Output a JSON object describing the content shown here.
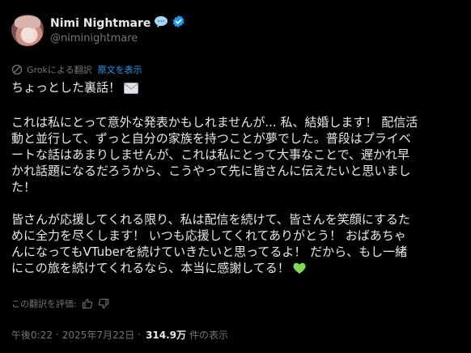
{
  "author": {
    "display_name": "Nimi Nightmare",
    "handle": "@niminightmare"
  },
  "translation": {
    "label": "Grokによる翻訳",
    "show_original": "原文を表示"
  },
  "post": {
    "line1": "ちょっとした裏話！",
    "para1_line1": "これは私にとって意外な発表かもしれませんが... 私、結婚します！ 配信活",
    "para1_line2": "動と並行して、ずっと自分の家族を持つことが夢でした。普段はプライベ",
    "para1_line3": "ートな話はあまりしませんが、これは私にとって大事なことで、遅かれ早",
    "para1_line4": "かれ話題になるだろうから、こうやって先に皆さんに伝えたいと思いまし",
    "para1_line5": "た！",
    "para2_line1": "皆さんが応援してくれる限り、私は配信を続けて、皆さんを笑顔にするた",
    "para2_line2": "めに全力を尽くします！ いつも応援してくれてありがとう！ おばあちゃ",
    "para2_line3": "んになってもVTuberを続けていきたいと思ってるよ！ だから、もし一緒",
    "para2_line4": "にこの旅を続けてくれるなら、本当に感謝してる！"
  },
  "rating": {
    "label": "この翻訳を評価:"
  },
  "meta": {
    "time": "午後0:22",
    "separator": "·",
    "date": "2025年7月22日",
    "views_count": "314.9万",
    "views_label": "件の表示"
  },
  "colors": {
    "background": "#000000",
    "text": "#e7e9ea",
    "muted": "#71767b",
    "accent": "#1d9bf0",
    "heart": "#7ed957"
  },
  "icons": {
    "badge1": "speech-bubble-icon",
    "badge2": "verified-badge-icon",
    "translate": "grok-icon",
    "envelope": "envelope-icon",
    "heart": "green-heart-icon",
    "thumbs_up": "thumbs-up-icon",
    "thumbs_down": "thumbs-down-icon"
  }
}
